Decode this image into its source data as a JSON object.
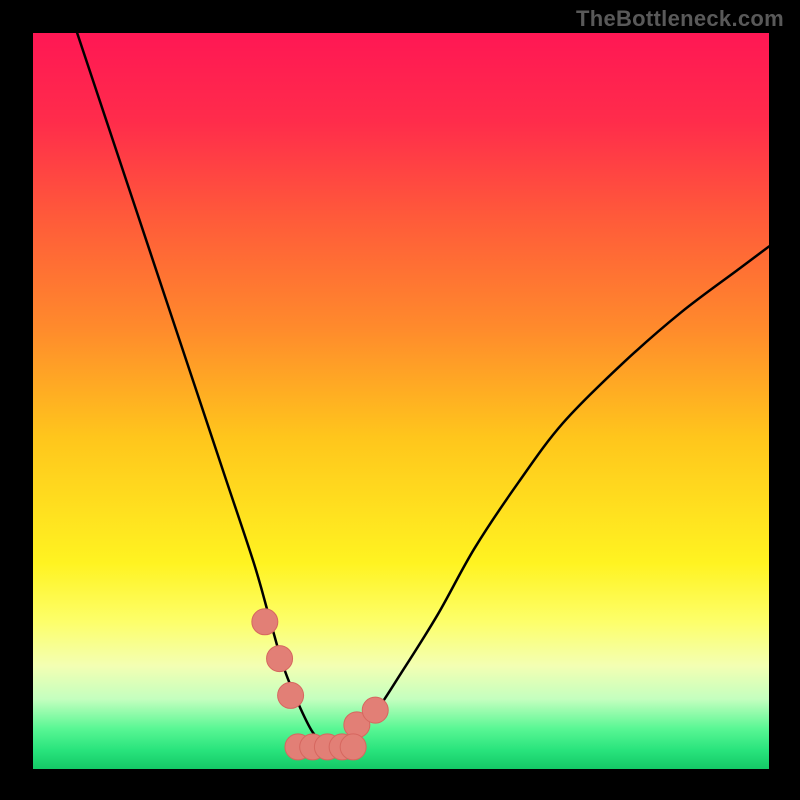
{
  "watermark_text": "TheBottleneck.com",
  "colors": {
    "bg": "#000000",
    "curve": "#000000",
    "marker_fill": "#e27f76",
    "marker_stroke": "#d6675f",
    "gradient_stops": [
      {
        "offset": 0.0,
        "color": "#ff1754"
      },
      {
        "offset": 0.12,
        "color": "#ff2c4b"
      },
      {
        "offset": 0.25,
        "color": "#ff5a3a"
      },
      {
        "offset": 0.4,
        "color": "#ff8a2c"
      },
      {
        "offset": 0.55,
        "color": "#ffc61c"
      },
      {
        "offset": 0.72,
        "color": "#fff321"
      },
      {
        "offset": 0.8,
        "color": "#fdff6a"
      },
      {
        "offset": 0.86,
        "color": "#f3ffb3"
      },
      {
        "offset": 0.905,
        "color": "#c4ffbf"
      },
      {
        "offset": 0.945,
        "color": "#59f794"
      },
      {
        "offset": 0.975,
        "color": "#28e37c"
      },
      {
        "offset": 1.0,
        "color": "#14c966"
      }
    ]
  },
  "chart_data": {
    "type": "line",
    "title": "",
    "xlabel": "",
    "ylabel": "",
    "xlim": [
      0,
      100
    ],
    "ylim": [
      0,
      100
    ],
    "x": [
      6,
      10,
      14,
      18,
      22,
      26,
      30,
      32,
      34,
      36,
      38,
      40,
      42,
      46,
      50,
      55,
      60,
      66,
      72,
      80,
      88,
      96,
      100
    ],
    "values": [
      100,
      88,
      76,
      64,
      52,
      40,
      28,
      21,
      14,
      9,
      5,
      3,
      3,
      7,
      13,
      21,
      30,
      39,
      47,
      55,
      62,
      68,
      71
    ],
    "markers": [
      {
        "label": "left-cluster-a",
        "x": 31.5,
        "y": 20
      },
      {
        "label": "left-cluster-b",
        "x": 33.5,
        "y": 15
      },
      {
        "label": "left-cluster-c",
        "x": 35.0,
        "y": 10
      },
      {
        "label": "right-cluster-a",
        "x": 44.0,
        "y": 6
      },
      {
        "label": "right-cluster-b",
        "x": 46.5,
        "y": 8
      },
      {
        "label": "floor-a",
        "x": 36.0,
        "y": 3
      },
      {
        "label": "floor-b",
        "x": 38.0,
        "y": 3
      },
      {
        "label": "floor-c",
        "x": 40.0,
        "y": 3
      },
      {
        "label": "floor-d",
        "x": 42.0,
        "y": 3
      },
      {
        "label": "floor-e",
        "x": 43.5,
        "y": 3
      }
    ]
  }
}
